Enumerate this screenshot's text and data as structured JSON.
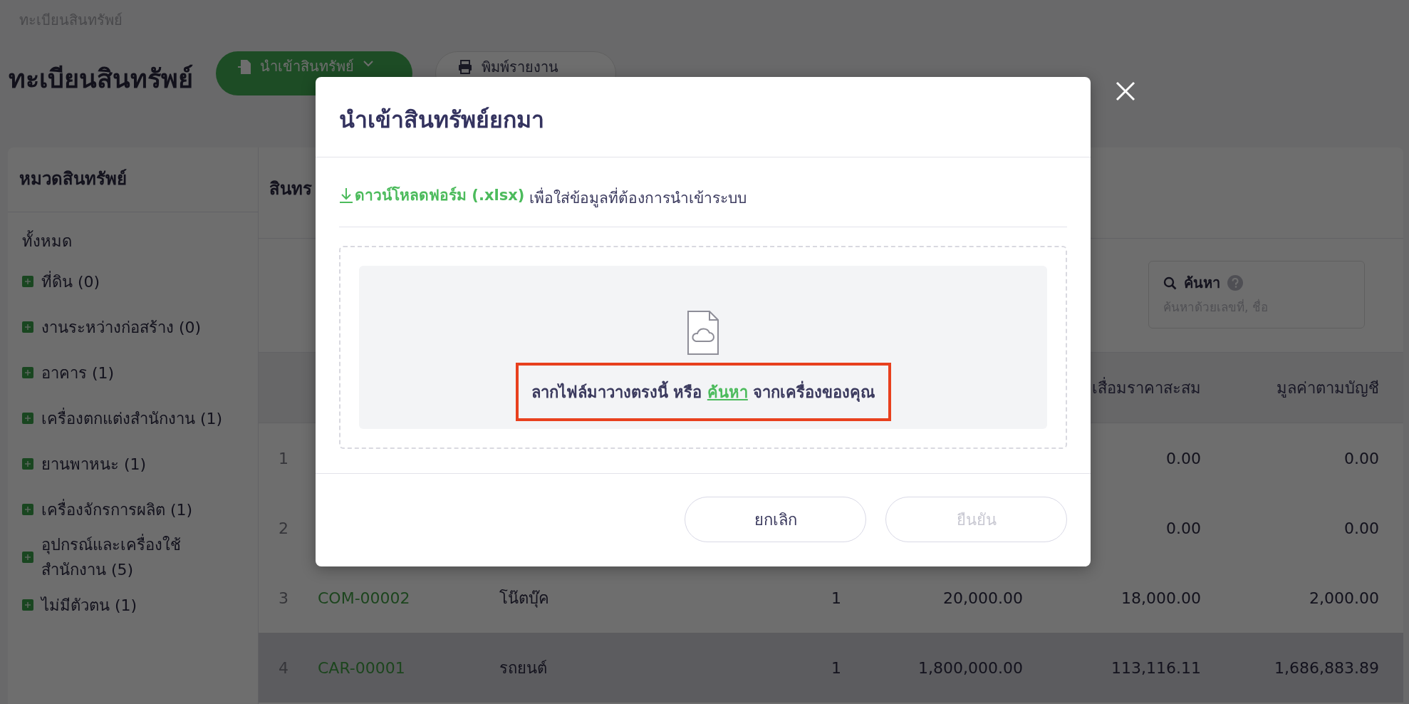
{
  "breadcrumb": "ทะเบียนสินทรัพย์",
  "page_title": "ทะเบียนสินทรัพย์",
  "header_buttons": [
    {
      "kind": "import",
      "label": "นำเข้าสินทรัพย์"
    },
    {
      "kind": "print",
      "label": "พิมพ์รายงาน"
    }
  ],
  "sidebar": {
    "title": "หมวดสินทรัพย์",
    "all_label": "ทั้งหมด",
    "categories": [
      "ที่ดิน (0)",
      "งานระหว่างก่อสร้าง (0)",
      "อาคาร (1)",
      "เครื่องตกแต่งสำนักงาน (1)",
      "ยานพาหนะ (1)",
      "เครื่องจักรการผลิต (1)",
      "อุปกรณ์และเครื่องใช้ สำนักงาน (5)",
      "ไม่มีตัวตน (1)"
    ]
  },
  "main": {
    "title": "สินทร",
    "search": {
      "label": "ค้นหา",
      "placeholder": "ค้นหาด้วยเลขที่, ชื่อ"
    },
    "table": {
      "columns": {
        "depreciation": "เสื่อมราคาสะสม",
        "book_value": "มูลค่าตามบัญชี"
      },
      "rows": [
        {
          "no": "1",
          "depreciation": "0.00",
          "book_value": "0.00",
          "highlighted": false
        },
        {
          "no": "2",
          "depreciation": "0.00",
          "book_value": "0.00",
          "highlighted": false
        },
        {
          "no": "3",
          "code": "COM-00002",
          "name": "โน๊ตบุ๊ค",
          "quantity": "1",
          "cost": "20,000.00",
          "depreciation": "18,000.00",
          "book_value": "2,000.00",
          "highlighted": false
        },
        {
          "no": "4",
          "code": "CAR-00001",
          "name": "รถยนต์",
          "quantity": "1",
          "cost": "1,800,000.00",
          "depreciation": "113,116.11",
          "book_value": "1,686,883.89",
          "highlighted": true
        }
      ]
    }
  },
  "modal": {
    "title": "นำเข้าสินทรัพย์ยกมา",
    "download": {
      "link": "ดาวน์โหลดฟอร์ม (.xlsx)",
      "text": "เพื่อใส่ข้อมูลที่ต้องการนำเข้าระบบ"
    },
    "dropzone": {
      "text_before": "ลากไฟล์มาวางตรงนี้ หรือ",
      "link": "ค้นหา",
      "text_after": "จากเครื่องของคุณ",
      "highlighted": true
    },
    "buttons": [
      {
        "label": "ยกเลิก",
        "disabled": false
      },
      {
        "label": "ยืนยัน",
        "disabled": true
      }
    ]
  }
}
